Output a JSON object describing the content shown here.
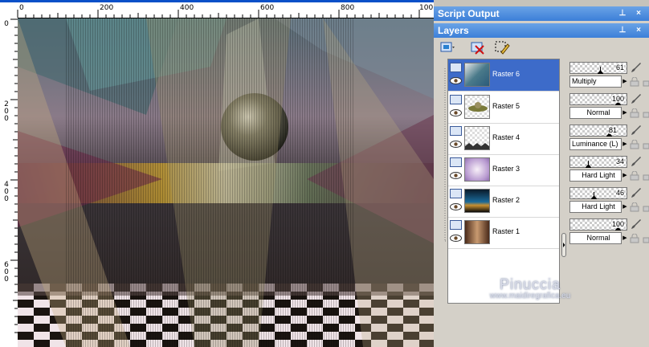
{
  "rulers": {
    "horizontal": [
      "0",
      "200",
      "400",
      "600",
      "800",
      "100"
    ],
    "vertical": [
      "0",
      "2\n0\n0",
      "4\n0\n0",
      "6\n0\n0"
    ]
  },
  "panels": {
    "script_output": {
      "title": "Script Output"
    },
    "layers": {
      "title": "Layers"
    }
  },
  "layers": [
    {
      "name": "Raster 6",
      "opacity": "61",
      "blend_mode": "Multiply",
      "selected": true
    },
    {
      "name": "Raster 5",
      "opacity": "100",
      "blend_mode": "Normal",
      "selected": false
    },
    {
      "name": "Raster 4",
      "opacity": "81",
      "blend_mode": "Luminance (L)",
      "selected": false
    },
    {
      "name": "Raster 3",
      "opacity": "34",
      "blend_mode": "Hard Light",
      "selected": false
    },
    {
      "name": "Raster 2",
      "opacity": "46",
      "blend_mode": "Hard Light",
      "selected": false
    },
    {
      "name": "Raster 1",
      "opacity": "100",
      "blend_mode": "Normal",
      "selected": false
    }
  ],
  "opacity_levels": [
    0.61,
    1.0,
    0.81,
    0.34,
    0.46,
    1.0
  ],
  "watermark": {
    "name": "Pinuccia",
    "url": "www.maidiregrafica.eu"
  },
  "colors": {
    "title_bar": "#3c7fd8",
    "selection": "#3d6bc9",
    "panel_bg": "#d4d0c8"
  },
  "icons": [
    "pin-icon",
    "close-icon",
    "new-layer-icon",
    "delete-layer-icon",
    "edit-selection-icon",
    "visibility-toggle-icon",
    "eye-icon",
    "brush-icon",
    "lock-icon"
  ]
}
